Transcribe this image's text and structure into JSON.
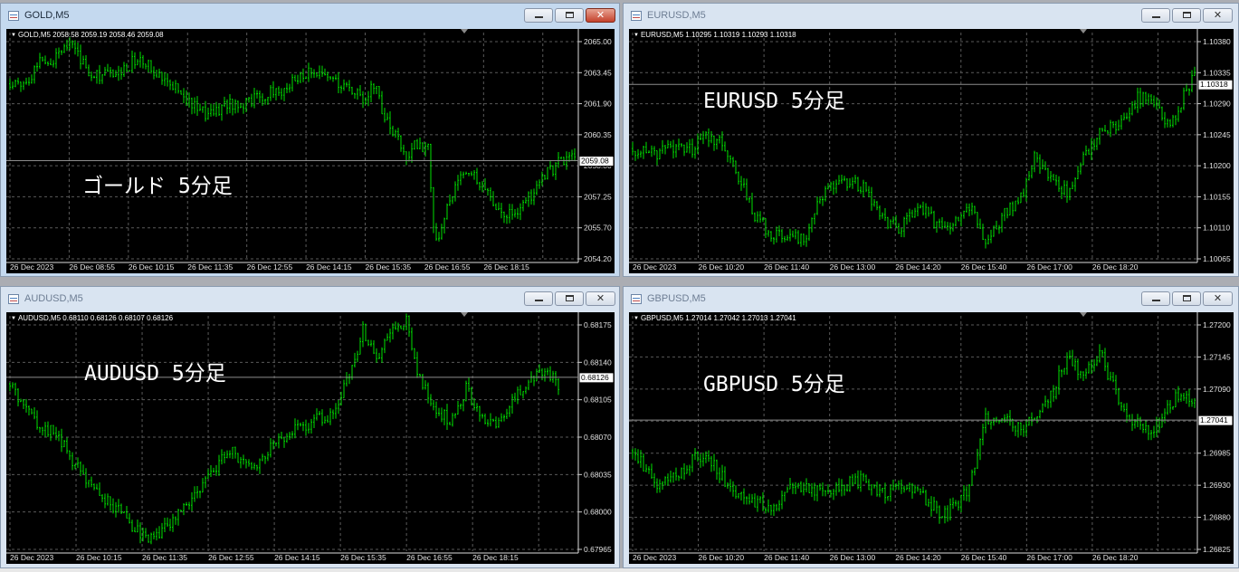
{
  "windows": [
    {
      "title": "GOLD,M5",
      "active": true,
      "info": "GOLD,M5  2058.58 2059.19 2058.46 2059.08",
      "caption": "ゴールド 5分足",
      "price_labels": [
        "2065.00",
        "2063.45",
        "2061.90",
        "2060.35",
        "2058.80",
        "2057.25",
        "2055.70",
        "2054.20"
      ],
      "time_labels": [
        "26 Dec 2023",
        "26 Dec 08:55",
        "26 Dec 10:15",
        "26 Dec 11:35",
        "26 Dec 12:55",
        "26 Dec 14:15",
        "26 Dec 15:35",
        "26 Dec 16:55",
        "26 Dec 18:15"
      ],
      "current_price": "2059.08",
      "chart_data": {
        "type": "line",
        "ylim": [
          2054.2,
          2065.0
        ],
        "x_count": 168,
        "keypoints": [
          [
            0,
            2062.9
          ],
          [
            6,
            2063.0
          ],
          [
            12,
            2064.3
          ],
          [
            16,
            2064.0
          ],
          [
            20,
            2065.0
          ],
          [
            24,
            2064.8
          ],
          [
            28,
            2063.6
          ],
          [
            34,
            2063.3
          ],
          [
            40,
            2063.4
          ],
          [
            46,
            2064.1
          ],
          [
            52,
            2063.7
          ],
          [
            58,
            2063.2
          ],
          [
            64,
            2062.3
          ],
          [
            70,
            2061.4
          ],
          [
            76,
            2061.6
          ],
          [
            80,
            2061.9
          ],
          [
            86,
            2062.0
          ],
          [
            92,
            2062.2
          ],
          [
            100,
            2062.6
          ],
          [
            110,
            2063.4
          ],
          [
            116,
            2063.2
          ],
          [
            124,
            2062.8
          ],
          [
            130,
            2062.1
          ],
          [
            134,
            2062.9
          ],
          [
            138,
            2061.2
          ],
          [
            142,
            2060.3
          ],
          [
            146,
            2059.2
          ],
          [
            150,
            2060.0
          ],
          [
            154,
            2059.7
          ],
          [
            156,
            2055.6
          ],
          [
            158,
            2055.0
          ],
          [
            162,
            2057.3
          ],
          [
            166,
            2058.3
          ],
          [
            170,
            2058.5
          ],
          [
            176,
            2057.6
          ],
          [
            180,
            2056.5
          ],
          [
            188,
            2056.6
          ],
          [
            196,
            2058.2
          ],
          [
            204,
            2059.2
          ],
          [
            210,
            2059.1
          ]
        ]
      }
    },
    {
      "title": "EURUSD,M5",
      "active": false,
      "info": "EURUSD,M5  1.10295 1.10319 1.10293 1.10318",
      "caption": "EURUSD 5分足",
      "price_labels": [
        "1.10380",
        "1.10335",
        "1.10290",
        "1.10245",
        "1.10200",
        "1.10155",
        "1.10110",
        "1.10065"
      ],
      "time_labels": [
        "26 Dec 2023",
        "26 Dec 10:20",
        "26 Dec 11:40",
        "26 Dec 13:00",
        "26 Dec 14:20",
        "26 Dec 15:40",
        "26 Dec 17:00",
        "26 Dec 18:20"
      ],
      "current_price": "1.10318",
      "chart_data": {
        "type": "line",
        "ylim": [
          1.10065,
          1.1038
        ],
        "x_count": 168,
        "keypoints": [
          [
            0,
            1.10225
          ],
          [
            8,
            1.10215
          ],
          [
            16,
            1.1023
          ],
          [
            22,
            1.10225
          ],
          [
            28,
            1.10245
          ],
          [
            34,
            1.1023
          ],
          [
            38,
            1.10195
          ],
          [
            44,
            1.10135
          ],
          [
            50,
            1.10105
          ],
          [
            58,
            1.10095
          ],
          [
            64,
            1.101
          ],
          [
            70,
            1.1016
          ],
          [
            78,
            1.10175
          ],
          [
            86,
            1.1017
          ],
          [
            92,
            1.1012
          ],
          [
            98,
            1.1011
          ],
          [
            106,
            1.1014
          ],
          [
            112,
            1.10115
          ],
          [
            118,
            1.1011
          ],
          [
            124,
            1.1014
          ],
          [
            130,
            1.10095
          ],
          [
            134,
            1.10115
          ],
          [
            138,
            1.10135
          ],
          [
            144,
            1.1016
          ],
          [
            148,
            1.1021
          ],
          [
            154,
            1.10185
          ],
          [
            160,
            1.1016
          ],
          [
            166,
            1.1021
          ],
          [
            172,
            1.10245
          ],
          [
            180,
            1.10265
          ],
          [
            186,
            1.103
          ],
          [
            192,
            1.1029
          ],
          [
            198,
            1.1026
          ],
          [
            204,
            1.1031
          ],
          [
            210,
            1.1035
          ],
          [
            216,
            1.1033
          ],
          [
            220,
            1.1031
          ]
        ]
      }
    },
    {
      "title": "AUDUSD,M5",
      "active": false,
      "info": "AUDUSD,M5  0.68110 0.68126 0.68107 0.68126",
      "caption": "AUDUSD 5分足",
      "price_labels": [
        "0.68175",
        "0.68140",
        "0.68105",
        "0.68070",
        "0.68035",
        "0.68000",
        "0.67965"
      ],
      "time_labels": [
        "26 Dec 2023",
        "26 Dec 10:15",
        "26 Dec 11:35",
        "26 Dec 12:55",
        "26 Dec 14:15",
        "26 Dec 15:35",
        "26 Dec 16:55",
        "26 Dec 18:15"
      ],
      "current_price": "0.68126",
      "chart_data": {
        "type": "line",
        "ylim": [
          0.67965,
          0.68175
        ],
        "x_count": 168,
        "keypoints": [
          [
            0,
            0.6812
          ],
          [
            6,
            0.68095
          ],
          [
            12,
            0.6808
          ],
          [
            18,
            0.6807
          ],
          [
            24,
            0.68045
          ],
          [
            30,
            0.6802
          ],
          [
            38,
            0.68005
          ],
          [
            46,
            0.67985
          ],
          [
            52,
            0.67975
          ],
          [
            58,
            0.6799
          ],
          [
            66,
            0.68005
          ],
          [
            74,
            0.6804
          ],
          [
            82,
            0.68055
          ],
          [
            90,
            0.68045
          ],
          [
            98,
            0.68065
          ],
          [
            106,
            0.6808
          ],
          [
            112,
            0.68085
          ],
          [
            118,
            0.6809
          ],
          [
            124,
            0.6812
          ],
          [
            130,
            0.6817
          ],
          [
            136,
            0.68145
          ],
          [
            140,
            0.68165
          ],
          [
            146,
            0.6818
          ],
          [
            150,
            0.6813
          ],
          [
            156,
            0.681
          ],
          [
            162,
            0.68085
          ],
          [
            168,
            0.68115
          ],
          [
            172,
            0.68095
          ],
          [
            178,
            0.6808
          ],
          [
            184,
            0.681
          ],
          [
            190,
            0.6812
          ],
          [
            196,
            0.6813
          ],
          [
            202,
            0.6812
          ]
        ]
      }
    },
    {
      "title": "GBPUSD,M5",
      "active": false,
      "info": "GBPUSD,M5  1.27014 1.27042 1.27013 1.27041",
      "caption": "GBPUSD 5分足",
      "price_labels": [
        "1.27200",
        "1.27145",
        "1.27090",
        "1.27040",
        "1.26985",
        "1.26930",
        "1.26880",
        "1.26825"
      ],
      "time_labels": [
        "26 Dec 2023",
        "26 Dec 10:20",
        "26 Dec 11:40",
        "26 Dec 13:00",
        "26 Dec 14:20",
        "26 Dec 15:40",
        "26 Dec 17:00",
        "26 Dec 18:20"
      ],
      "current_price": "1.27041",
      "chart_data": {
        "type": "line",
        "ylim": [
          1.26825,
          1.272
        ],
        "x_count": 168,
        "keypoints": [
          [
            0,
            1.2699
          ],
          [
            8,
            1.26935
          ],
          [
            16,
            1.26945
          ],
          [
            24,
            1.26985
          ],
          [
            30,
            1.26965
          ],
          [
            36,
            1.2693
          ],
          [
            44,
            1.26905
          ],
          [
            52,
            1.26895
          ],
          [
            60,
            1.26935
          ],
          [
            68,
            1.26925
          ],
          [
            76,
            1.2693
          ],
          [
            84,
            1.2694
          ],
          [
            92,
            1.2692
          ],
          [
            100,
            1.2693
          ],
          [
            108,
            1.2691
          ],
          [
            114,
            1.2688
          ],
          [
            118,
            1.26895
          ],
          [
            124,
            1.2693
          ],
          [
            130,
            1.27045
          ],
          [
            136,
            1.2705
          ],
          [
            142,
            1.27025
          ],
          [
            148,
            1.2704
          ],
          [
            154,
            1.2708
          ],
          [
            160,
            1.27145
          ],
          [
            166,
            1.2712
          ],
          [
            172,
            1.27155
          ],
          [
            178,
            1.27085
          ],
          [
            184,
            1.2704
          ],
          [
            190,
            1.2702
          ],
          [
            196,
            1.2705
          ],
          [
            202,
            1.2709
          ],
          [
            208,
            1.2707
          ],
          [
            214,
            1.2704
          ]
        ]
      }
    }
  ]
}
